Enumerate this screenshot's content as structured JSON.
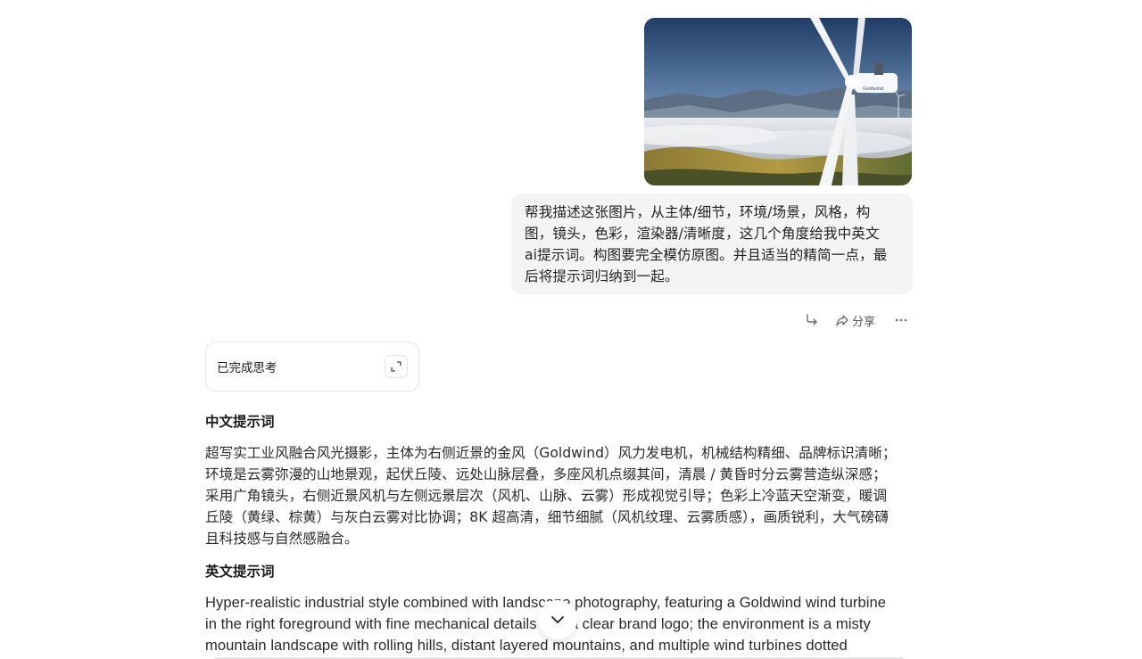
{
  "uploaded_image": {
    "brand_text": "Goldwind"
  },
  "user_message": {
    "lines": [
      "帮我描述这张图片，从主体/细节，环境/场景，风格，构",
      "图，镜头，色彩，渲染器/清晰度，这几个角度给我中英文",
      "ai提示词。构图要完全模仿原图。并且适当的精简一点，最",
      "后将提示词归纳到一起。"
    ]
  },
  "message_actions": {
    "share_label": "分享"
  },
  "thinking": {
    "label": "已完成思考"
  },
  "answer": {
    "zh_heading": "中文提示词",
    "zh_lines": [
      "超写实工业风融合风光摄影，主体为右侧近景的金风（Goldwind）风力发电机，机械结构精细、品牌标识清晰；",
      "环境是云雾弥漫的山地景观，起伏丘陵、远处山脉层叠，多座风机点缀其间，清晨 / 黄昏时分云雾营造纵深感；",
      "采用广角镜头，右侧近景风机与左侧远景层次（风机、山脉、云雾）形成视觉引导；色彩上冷蓝天空渐变，暖调",
      "丘陵（黄绿、棕黄）与灰白云雾对比协调；8K 超高清，细节细腻（风机纹理、云雾质感），画质锐利，大气磅礴",
      "且科技感与自然感融合。"
    ],
    "en_heading": "英文提示词",
    "en_lines": [
      "Hyper-realistic industrial style combined with landscape photography, featuring a Goldwind wind turbine",
      "in the right foreground with fine mechanical details and a clear brand logo; the environment is a misty",
      "mountain landscape with rolling hills, distant layered mountains, and multiple wind turbines dotted"
    ]
  },
  "colors": {
    "bubble_bg": "#f4f4f5",
    "text": "#222222",
    "border": "#e4e4e7"
  }
}
